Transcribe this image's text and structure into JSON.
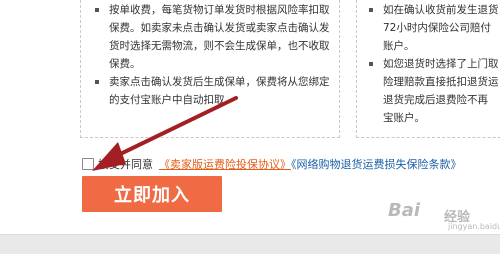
{
  "left_panel": {
    "items": [
      {
        "lines": [
          "按单收费，每笔货物订单发货时根据风险率扣取",
          "保费。如卖家未点击确认发货或卖家点击确认发",
          "货时选择无需物流，则不会生成保单，也不收取",
          "保费。"
        ]
      },
      {
        "lines": [
          "卖家点击确认发货后生成保单，保费将从您绑定",
          "的支付宝账户中自动扣取。"
        ]
      }
    ]
  },
  "right_panel": {
    "items": [
      {
        "lines": [
          "如在确认收货前发生退货",
          "72小时内保险公司赔付",
          "账户。"
        ]
      },
      {
        "lines": [
          "如您退货时选择了上门取",
          "险理赔款直接抵扣退货运",
          "退货完成后退费险不再",
          "宝账户。"
        ]
      }
    ]
  },
  "agreement": {
    "text": "接受并同意",
    "link1": "《卖家版运费险投保协议》",
    "link2": "《网络购物退货运费损失保险条款》",
    "checked": false
  },
  "join_button": {
    "label": "立即加入"
  },
  "watermark": {
    "main": "Bai",
    "sub": "经验",
    "url": "jingyan.baidu.com"
  },
  "colors": {
    "accent": "#f06b43",
    "link": "#1a5fa8",
    "link_active": "#e55c19",
    "arrow": "#a31f24"
  }
}
